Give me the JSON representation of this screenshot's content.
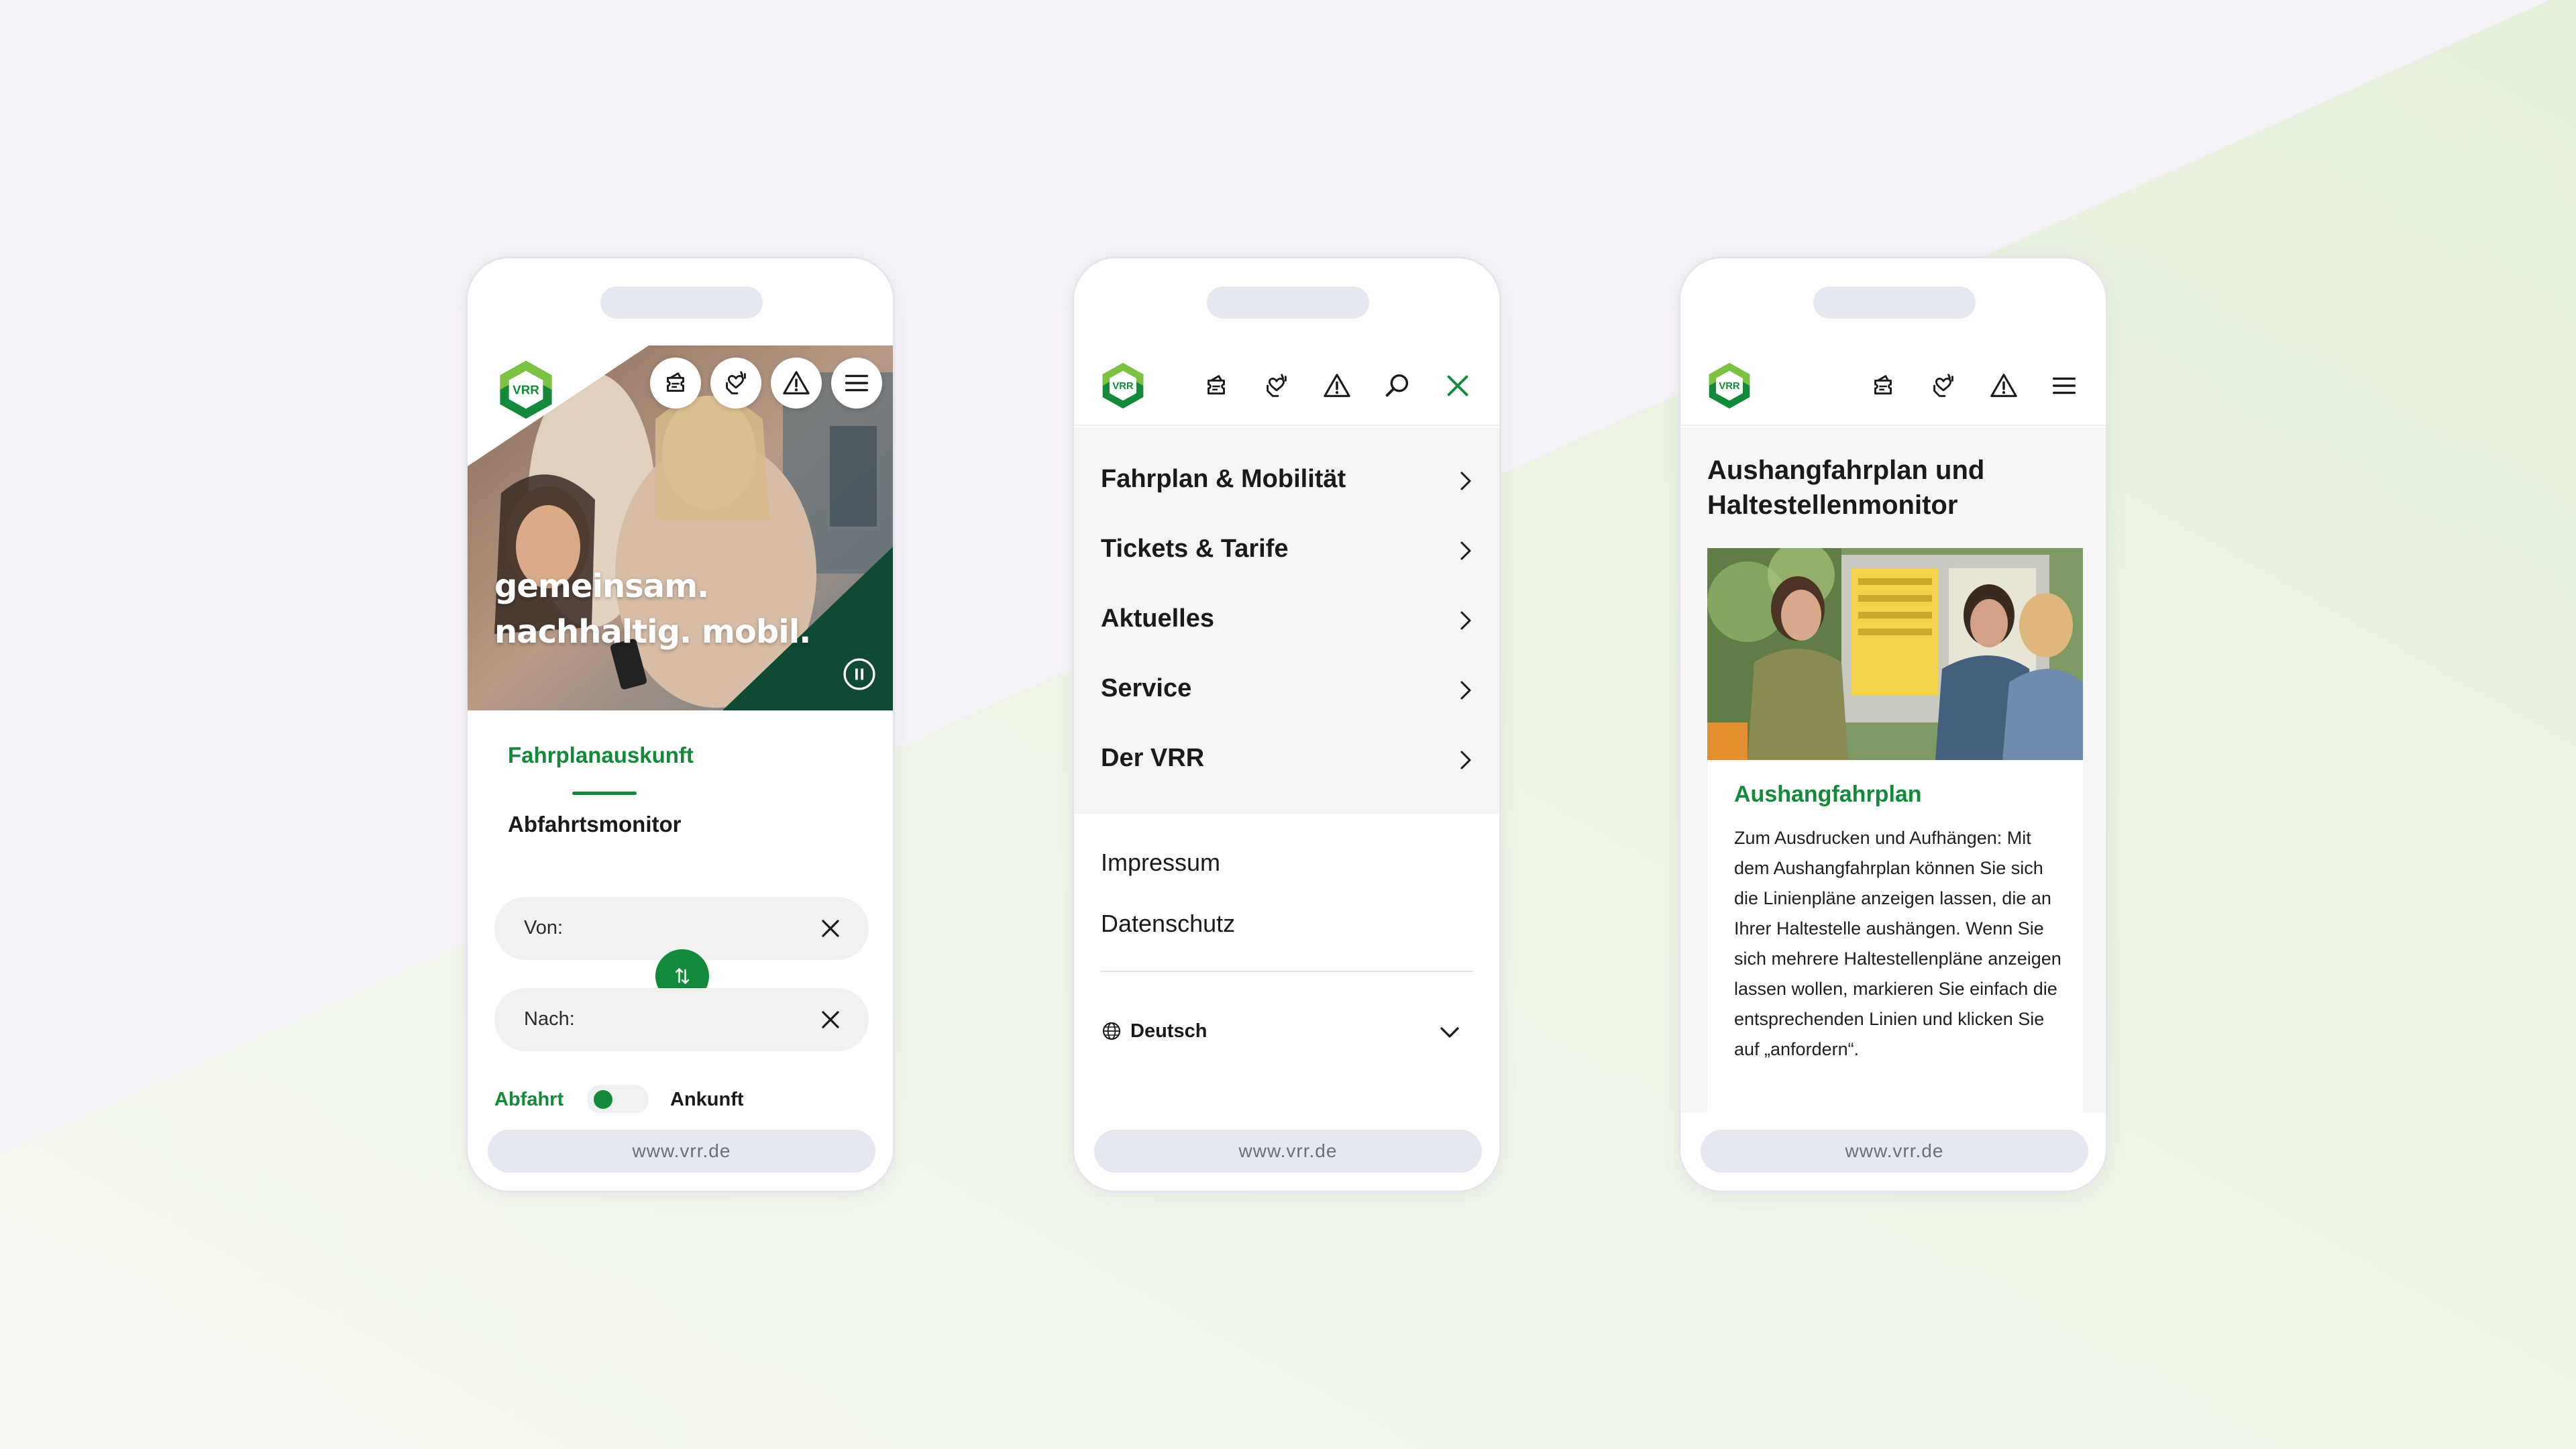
{
  "colors": {
    "brand_green": "#128a3a",
    "dark_green": "#0f4a34",
    "background_lavender": "#f4f1f7",
    "background_green": "#eef5e8"
  },
  "phones": [
    {
      "screen": "start",
      "url": "www.vrr.de",
      "header_icons": [
        "ticket-icon",
        "heart-hands-icon",
        "warning-icon",
        "menu-icon"
      ],
      "logo_text": "VRR",
      "hero": {
        "slogan_line1": "gemeinsam.",
        "slogan_line2": "nachhaltig. mobil."
      },
      "tabs": {
        "active": "Fahrplanauskunft",
        "inactive": "Abfahrtsmonitor"
      },
      "fields": {
        "from_label": "Von:",
        "to_label": "Nach:"
      },
      "toggle": {
        "left": "Abfahrt",
        "right": "Ankunft",
        "selected": "Abfahrt"
      }
    },
    {
      "screen": "menu",
      "url": "www.vrr.de",
      "logo_text": "VRR",
      "header_icons": [
        "ticket-icon",
        "heart-hands-icon",
        "warning-icon",
        "search-icon",
        "close-icon"
      ],
      "menu_items": [
        "Fahrplan & Mobilität",
        "Tickets & Tarife",
        "Aktuelles",
        "Service",
        "Der VRR"
      ],
      "secondary_links": [
        "Impressum",
        "Datenschutz"
      ],
      "language": "Deutsch"
    },
    {
      "screen": "article",
      "url": "www.vrr.de",
      "logo_text": "VRR",
      "header_icons": [
        "ticket-icon",
        "heart-hands-icon",
        "warning-icon",
        "menu-icon"
      ],
      "page_title": "Aushangfahrplan und Haltestellenmonitor",
      "card": {
        "title": "Aushangfahrplan",
        "text": "Zum Ausdrucken und Aufhängen: Mit dem Aushangfahrplan können Sie sich die Linienpläne anzeigen lassen, die an Ihrer Haltestelle aushängen. Wenn Sie sich mehrere Haltestellenpläne anzeigen lassen wollen, markieren Sie einfach die entsprechenden Linien und klicken Sie auf „anfordern“."
      }
    }
  ]
}
